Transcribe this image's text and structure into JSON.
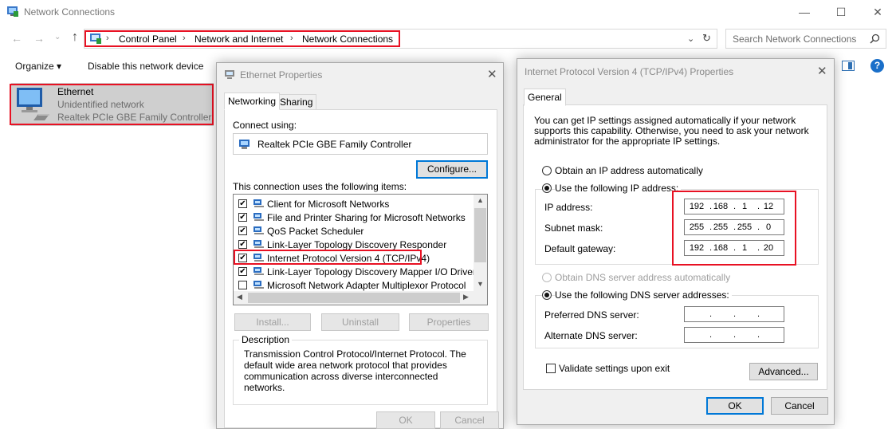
{
  "window": {
    "title": "Network Connections",
    "minimize": "—",
    "maximize": "☐",
    "close": "✕"
  },
  "address": {
    "crumbs": [
      "Control Panel",
      "Network and Internet",
      "Network Connections"
    ],
    "search_placeholder": "Search Network Connections"
  },
  "toolbar": {
    "organize": "Organize ▾",
    "disable": "Disable this network device"
  },
  "connection": {
    "name": "Ethernet",
    "status": "Unidentified network",
    "adapter": "Realtek PCIe GBE Family Controller"
  },
  "eth_props": {
    "title": "Ethernet Properties",
    "tabs": [
      "Networking",
      "Sharing"
    ],
    "connect_using_label": "Connect using:",
    "adapter": "Realtek PCIe GBE Family Controller",
    "configure": "Configure...",
    "items_label": "This connection uses the following items:",
    "items": [
      {
        "label": "Client for Microsoft Networks",
        "checked": true
      },
      {
        "label": "File and Printer Sharing for Microsoft Networks",
        "checked": true
      },
      {
        "label": "QoS Packet Scheduler",
        "checked": true
      },
      {
        "label": "Link-Layer Topology Discovery Responder",
        "checked": true
      },
      {
        "label": "Internet Protocol Version 4 (TCP/IPv4)",
        "checked": true
      },
      {
        "label": "Link-Layer Topology Discovery Mapper I/O Driver",
        "checked": true
      },
      {
        "label": "Microsoft Network Adapter Multiplexor Protocol",
        "checked": false
      }
    ],
    "install": "Install...",
    "uninstall": "Uninstall",
    "properties": "Properties",
    "description_label": "Description",
    "description": "Transmission Control Protocol/Internet Protocol. The default wide area network protocol that provides communication across diverse interconnected networks.",
    "ok": "OK",
    "cancel": "Cancel"
  },
  "ipv4": {
    "title": "Internet Protocol Version 4 (TCP/IPv4) Properties",
    "tab": "General",
    "intro": "You can get IP settings assigned automatically if your network supports this capability. Otherwise, you need to ask your network administrator for the appropriate IP settings.",
    "obtain_ip_auto": "Obtain an IP address automatically",
    "use_ip": "Use the following IP address:",
    "ip_label": "IP address:",
    "ip": [
      "192",
      "168",
      "1",
      "12"
    ],
    "mask_label": "Subnet mask:",
    "mask": [
      "255",
      "255",
      "255",
      "0"
    ],
    "gateway_label": "Default gateway:",
    "gateway": [
      "192",
      "168",
      "1",
      "20"
    ],
    "obtain_dns_auto": "Obtain DNS server address automatically",
    "use_dns": "Use the following DNS server addresses:",
    "pref_dns_label": "Preferred DNS server:",
    "alt_dns_label": "Alternate DNS server:",
    "validate": "Validate settings upon exit",
    "advanced": "Advanced...",
    "ok": "OK",
    "cancel": "Cancel"
  }
}
